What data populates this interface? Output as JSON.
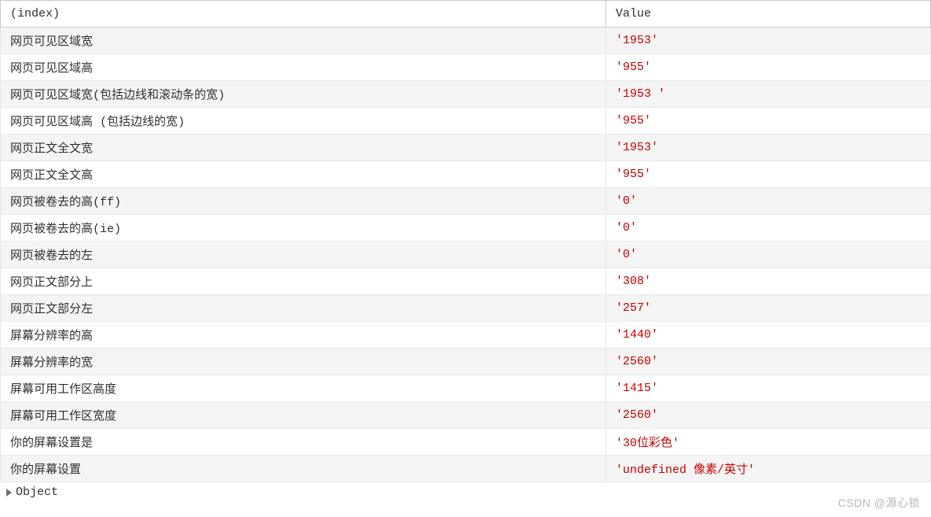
{
  "headers": {
    "index": "(index)",
    "value": "Value"
  },
  "rows": [
    {
      "index": "网页可见区域宽",
      "value": "'1953'"
    },
    {
      "index": "网页可见区域高",
      "value": "'955'"
    },
    {
      "index": "网页可见区域宽(包括边线和滚动条的宽)",
      "value": "'1953 '"
    },
    {
      "index": "网页可见区域高 (包括边线的宽)",
      "value": "'955'"
    },
    {
      "index": "网页正文全文宽",
      "value": "'1953'"
    },
    {
      "index": "网页正文全文高",
      "value": "'955'"
    },
    {
      "index": "网页被卷去的高(ff)",
      "value": "'0'"
    },
    {
      "index": "网页被卷去的高(ie)",
      "value": "'0'"
    },
    {
      "index": "网页被卷去的左",
      "value": "'0'"
    },
    {
      "index": "网页正文部分上",
      "value": "'308'"
    },
    {
      "index": "网页正文部分左",
      "value": "'257'"
    },
    {
      "index": "屏幕分辨率的高",
      "value": "'1440'"
    },
    {
      "index": "屏幕分辨率的宽",
      "value": "'2560'"
    },
    {
      "index": "屏幕可用工作区高度",
      "value": "'1415'"
    },
    {
      "index": "屏幕可用工作区宽度",
      "value": "'2560'"
    },
    {
      "index": "你的屏幕设置是",
      "value": "'30位彩色'"
    },
    {
      "index": "你的屏幕设置",
      "value": "'undefined 像素/英寸'"
    }
  ],
  "object_label": "Object",
  "watermark": "CSDN @源心锁"
}
